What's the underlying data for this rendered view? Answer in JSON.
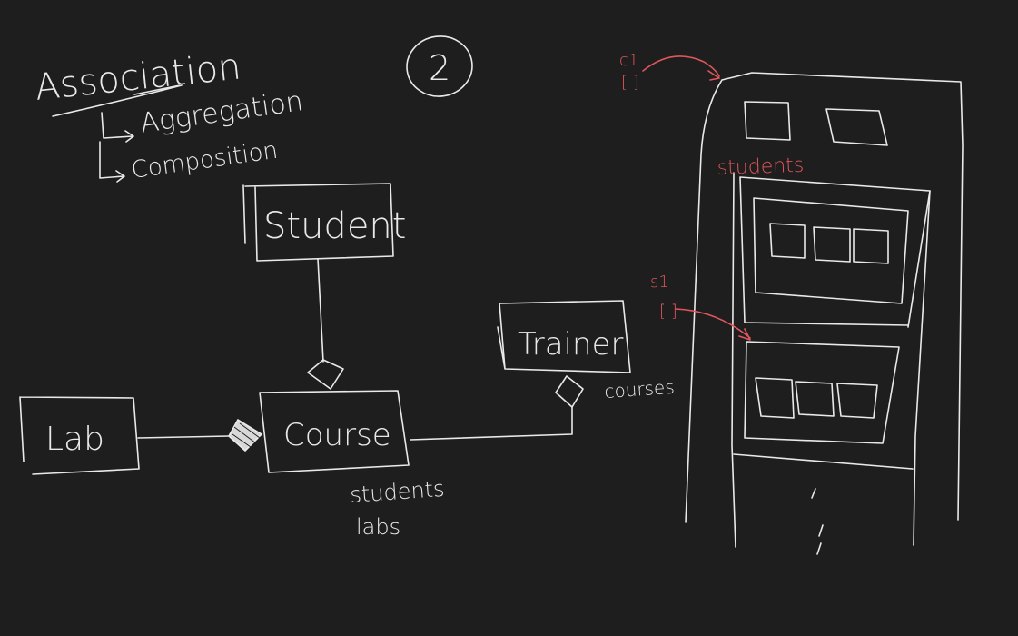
{
  "colors": {
    "background": "#1e1e1e",
    "ink": "#e9e9e9",
    "accent": "#e0565c"
  },
  "notes": {
    "heading": "Association",
    "sub_1": "Aggregation",
    "sub_2": "Composition",
    "page_number": "2"
  },
  "classes": {
    "student": "Student",
    "course": "Course",
    "trainer": "Trainer",
    "lab": "Lab"
  },
  "field_notes": {
    "course_fields_1": "students",
    "course_fields_2": "labs",
    "trainer_field": "courses"
  },
  "memory_sketch": {
    "label_c1_top": "c1",
    "label_c1_bottom": "[ ]",
    "label_students": "students",
    "label_s1_top": "s1",
    "label_s1_bottom": "[ ]"
  }
}
